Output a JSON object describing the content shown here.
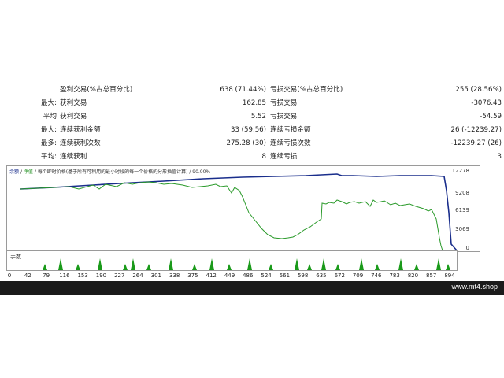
{
  "stats": [
    {
      "a": "",
      "b": "盈利交易(%占总百分比)",
      "c": "638 (71.44%)",
      "d": "亏损交易(%占总百分比)",
      "e": "255 (28.56%)"
    },
    {
      "a": "最大:",
      "b": "获利交易",
      "c": "162.85",
      "d": "亏损交易",
      "e": "-3076.43"
    },
    {
      "a": "平均",
      "b": "获利交易",
      "c": "5.52",
      "d": "亏损交易",
      "e": "-54.59"
    },
    {
      "a": "最大:",
      "b": "连续获利金额",
      "c": "33 (59.56)",
      "d": "连续亏损金额",
      "e": "26 (-12239.27)"
    },
    {
      "a": "最多:",
      "b": "连续获利次数",
      "c": "275.28 (30)",
      "d": "连续亏损次数",
      "e": "-12239.27 (26)"
    },
    {
      "a": "平均:",
      "b": "连续获利",
      "c": "8",
      "d": "连续亏损",
      "e": "3"
    }
  ],
  "chart": {
    "legend_balance": "余额",
    "legend_equity": "净值",
    "legend_note": "每个即时价格(基于所有可利用的最小时段的每一个价格的分形插值计算) / 90.00%",
    "yticks": [
      "12278",
      "9208",
      "6139",
      "3069",
      "0"
    ],
    "xticks": [
      "0",
      "42",
      "79",
      "116",
      "153",
      "190",
      "227",
      "264",
      "301",
      "338",
      "375",
      "412",
      "449",
      "486",
      "524",
      "561",
      "598",
      "635",
      "672",
      "709",
      "746",
      "783",
      "820",
      "857",
      "894"
    ],
    "volume_label": "手数",
    "colors": {
      "balance": "#1a2e8c",
      "equity": "#2a9a2a",
      "volume": "#1a9a1a"
    }
  },
  "footer": {
    "brand": "www.mt4.shop"
  }
}
